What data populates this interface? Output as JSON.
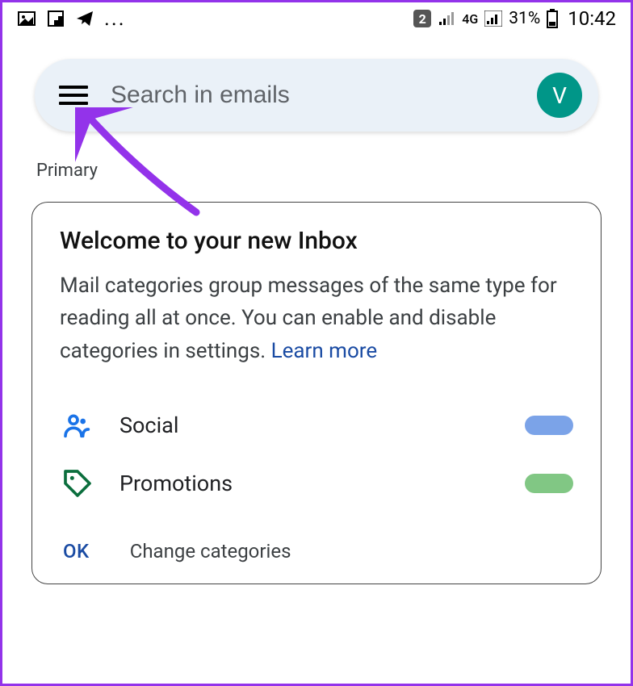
{
  "status_bar": {
    "sim_count": "2",
    "network_label": "4G",
    "battery_percent": "31%",
    "time": "10:42",
    "dots": "..."
  },
  "search": {
    "placeholder": "Search in emails",
    "avatar_letter": "V"
  },
  "section": {
    "label": "Primary"
  },
  "welcome_card": {
    "title": "Welcome to your new Inbox",
    "body": "Mail categories group messages of the same type for reading all at once. You can enable and disable categories in settings. ",
    "learn_more": "Learn more",
    "categories": {
      "social": "Social",
      "promotions": "Promotions"
    },
    "ok_label": "OK",
    "change_label": "Change categories"
  }
}
